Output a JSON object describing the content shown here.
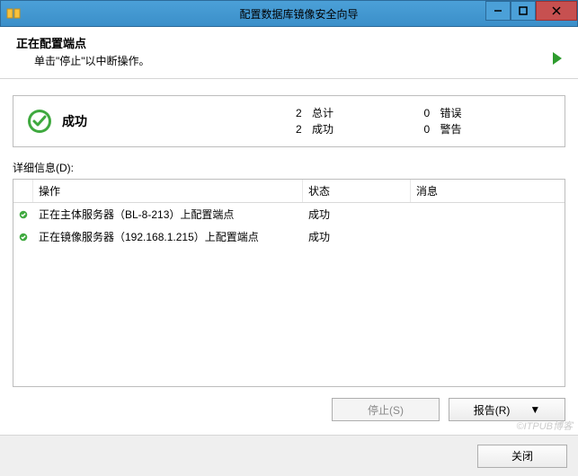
{
  "window": {
    "title": "配置数据库镜像安全向导"
  },
  "header": {
    "title": "正在配置端点",
    "subtitle": "单击\"停止\"以中断操作。"
  },
  "summary": {
    "status_label": "成功",
    "total_label": "总计",
    "total_count": "2",
    "success_label": "成功",
    "success_count": "2",
    "error_label": "错误",
    "error_count": "0",
    "warning_label": "警告",
    "warning_count": "0"
  },
  "details": {
    "label": "详细信息(D):",
    "columns": {
      "operation": "操作",
      "status": "状态",
      "message": "消息"
    },
    "rows": [
      {
        "operation": "正在主体服务器（BL-8-213）上配置端点",
        "status": "成功",
        "message": ""
      },
      {
        "operation": "正在镜像服务器（192.168.1.215）上配置端点",
        "status": "成功",
        "message": ""
      }
    ]
  },
  "buttons": {
    "stop": "停止(S)",
    "report": "报告(R)",
    "close": "关闭"
  },
  "watermark": "©ITPUB博客"
}
